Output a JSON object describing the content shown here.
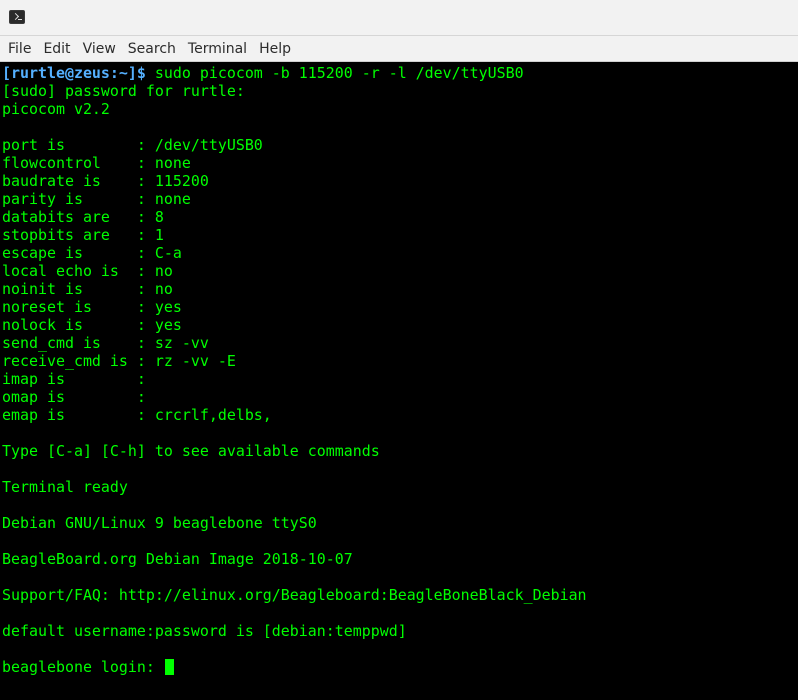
{
  "titlebar": {
    "icon": "terminal-icon"
  },
  "menu": [
    "File",
    "Edit",
    "View",
    "Search",
    "Terminal",
    "Help"
  ],
  "terminal": {
    "prompt": "[rurtle@zeus:~]$",
    "command": " sudo picocom -b 115200 -r -l /dev/ttyUSB0",
    "lines": [
      "[sudo] password for rurtle:",
      "picocom v2.2",
      "",
      "port is        : /dev/ttyUSB0",
      "flowcontrol    : none",
      "baudrate is    : 115200",
      "parity is      : none",
      "databits are   : 8",
      "stopbits are   : 1",
      "escape is      : C-a",
      "local echo is  : no",
      "noinit is      : no",
      "noreset is     : yes",
      "nolock is      : yes",
      "send_cmd is    : sz -vv",
      "receive_cmd is : rz -vv -E",
      "imap is        :",
      "omap is        :",
      "emap is        : crcrlf,delbs,",
      "",
      "Type [C-a] [C-h] to see available commands",
      "",
      "Terminal ready",
      "",
      "Debian GNU/Linux 9 beaglebone ttyS0",
      "",
      "BeagleBoard.org Debian Image 2018-10-07",
      "",
      "Support/FAQ: http://elinux.org/Beagleboard:BeagleBoneBlack_Debian",
      "",
      "default username:password is [debian:temppwd]",
      ""
    ],
    "login_prompt": "beaglebone login: "
  }
}
